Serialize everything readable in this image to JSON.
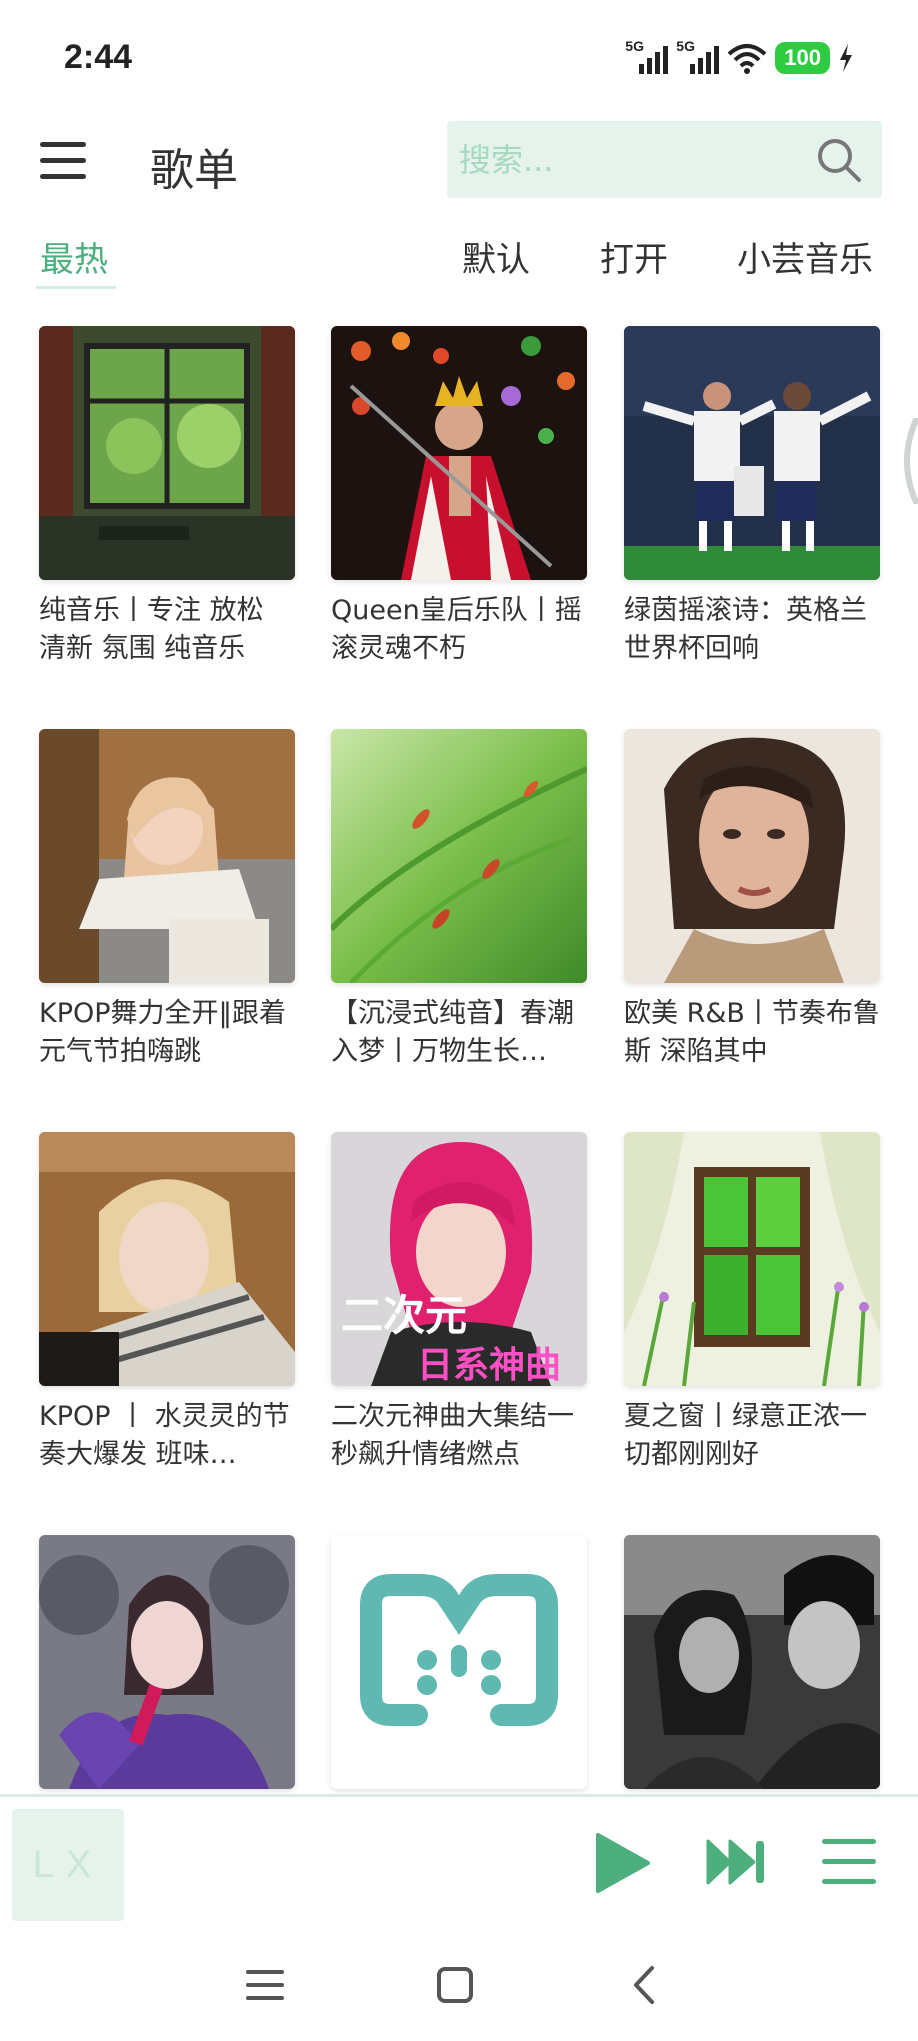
{
  "status_bar": {
    "time": "2:44",
    "signal_1_label": "5G",
    "signal_2_label": "5G",
    "battery": "100",
    "icons": [
      "signal-5g-icon",
      "signal-5g-icon",
      "wifi-icon",
      "battery-icon",
      "charging-bolt-icon"
    ]
  },
  "header": {
    "title": "歌单",
    "search_placeholder": "搜索...",
    "search_value": ""
  },
  "tabs": {
    "items": [
      "最热",
      "默认",
      "打开",
      "小芸音乐"
    ],
    "active": "最热"
  },
  "playlists": [
    {
      "title": "纯音乐丨专注 放松 清新 氛围 纯音乐",
      "cover": "window-room"
    },
    {
      "title": "Queen皇后乐队丨摇滚灵魂不朽",
      "cover": "stage-king"
    },
    {
      "title": "绿茵摇滚诗：英格兰世界杯回响",
      "cover": "football"
    },
    {
      "title": "KPOP舞力全开‖跟着元气节拍嗨跳",
      "cover": "portrait-sofa"
    },
    {
      "title": "【沉浸式纯音】春潮入梦丨万物生长…",
      "cover": "green-leaves"
    },
    {
      "title": "欧美 R&B丨节奏布鲁斯 深陷其中",
      "cover": "portrait-bed"
    },
    {
      "title": "KPOP 丨 水灵灵的节奏大爆发 班味…",
      "cover": "portrait-scarf"
    },
    {
      "title": "二次元神曲大集结一秒飙升情绪燃点",
      "cover": "anime-pink"
    },
    {
      "title": "夏之窗丨绿意正浓一切都刚刚好",
      "cover": "open-window"
    },
    {
      "title": "",
      "cover": "singer-purple"
    },
    {
      "title": "",
      "cover": "lx-logo"
    },
    {
      "title": "",
      "cover": "bw-couple"
    }
  ],
  "cover_texts": {
    "anime_line1": "二次元",
    "anime_line2": "日系神曲"
  },
  "player": {
    "logo_text": "LX",
    "accent": "#4caf7d"
  },
  "colors": {
    "accent": "#4caf7d",
    "search_bg": "#e6f3ec",
    "text": "#333333"
  }
}
